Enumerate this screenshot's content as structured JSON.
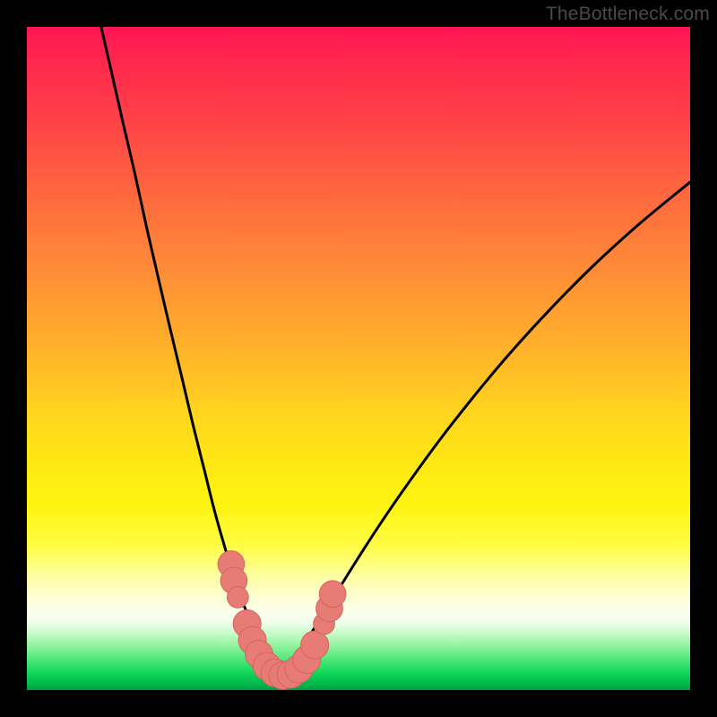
{
  "attribution": "TheBottleneck.com",
  "colors": {
    "frame": "#000000",
    "curve_stroke": "#000000",
    "marker_fill": "#e77c76",
    "marker_stroke": "#d9625c",
    "gradient_top": "#ff1553",
    "gradient_bottom": "#009944"
  },
  "chart_data": {
    "type": "line",
    "title": "",
    "xlabel": "",
    "ylabel": "",
    "xlim": [
      0,
      100
    ],
    "ylim": [
      0,
      100
    ],
    "note": "x,y are percent of plot area (0,0 = top-left). Two thin black curves forming a V; minimum near x≈35, y≈98.",
    "series": [
      {
        "name": "left-branch",
        "x": [
          11.2,
          12.8,
          14.5,
          16.3,
          18.0,
          19.8,
          21.6,
          23.4,
          25.1,
          26.8,
          28.3,
          29.8,
          31.2,
          32.4,
          33.6,
          34.7,
          35.7,
          36.6,
          37.3,
          37.9,
          38.3
        ],
        "y": [
          0.0,
          7.0,
          14.5,
          22.2,
          30.0,
          37.8,
          45.5,
          53.0,
          60.2,
          67.0,
          73.0,
          78.3,
          82.8,
          86.4,
          89.3,
          91.6,
          93.4,
          94.9,
          96.0,
          96.9,
          97.5
        ]
      },
      {
        "name": "right-branch",
        "x": [
          38.3,
          39.3,
          40.6,
          42.3,
          44.4,
          47.0,
          50.0,
          53.5,
          57.5,
          62.0,
          67.0,
          72.5,
          78.5,
          85.0,
          92.0,
          100.0
        ],
        "y": [
          97.5,
          96.5,
          94.8,
          92.3,
          89.0,
          84.8,
          80.0,
          74.6,
          68.8,
          62.6,
          56.2,
          49.6,
          43.0,
          36.4,
          30.0,
          23.4
        ]
      }
    ],
    "markers": {
      "note": "Rounded pink markers near the trough",
      "points": [
        {
          "x": 30.8,
          "y": 81.0,
          "r": 2.0
        },
        {
          "x": 31.2,
          "y": 83.5,
          "r": 2.0
        },
        {
          "x": 31.8,
          "y": 86.0,
          "r": 1.6
        },
        {
          "x": 33.2,
          "y": 90.0,
          "r": 2.1
        },
        {
          "x": 34.0,
          "y": 92.5,
          "r": 2.1
        },
        {
          "x": 35.0,
          "y": 94.6,
          "r": 2.1
        },
        {
          "x": 36.2,
          "y": 96.4,
          "r": 2.1
        },
        {
          "x": 37.4,
          "y": 97.4,
          "r": 2.1
        },
        {
          "x": 38.6,
          "y": 97.8,
          "r": 2.1
        },
        {
          "x": 39.8,
          "y": 97.6,
          "r": 2.1
        },
        {
          "x": 41.0,
          "y": 96.8,
          "r": 2.1
        },
        {
          "x": 42.2,
          "y": 95.4,
          "r": 2.1
        },
        {
          "x": 43.4,
          "y": 93.2,
          "r": 2.1
        },
        {
          "x": 44.8,
          "y": 90.0,
          "r": 1.6
        },
        {
          "x": 45.6,
          "y": 87.7,
          "r": 2.0
        },
        {
          "x": 46.1,
          "y": 85.5,
          "r": 2.0
        }
      ]
    }
  }
}
